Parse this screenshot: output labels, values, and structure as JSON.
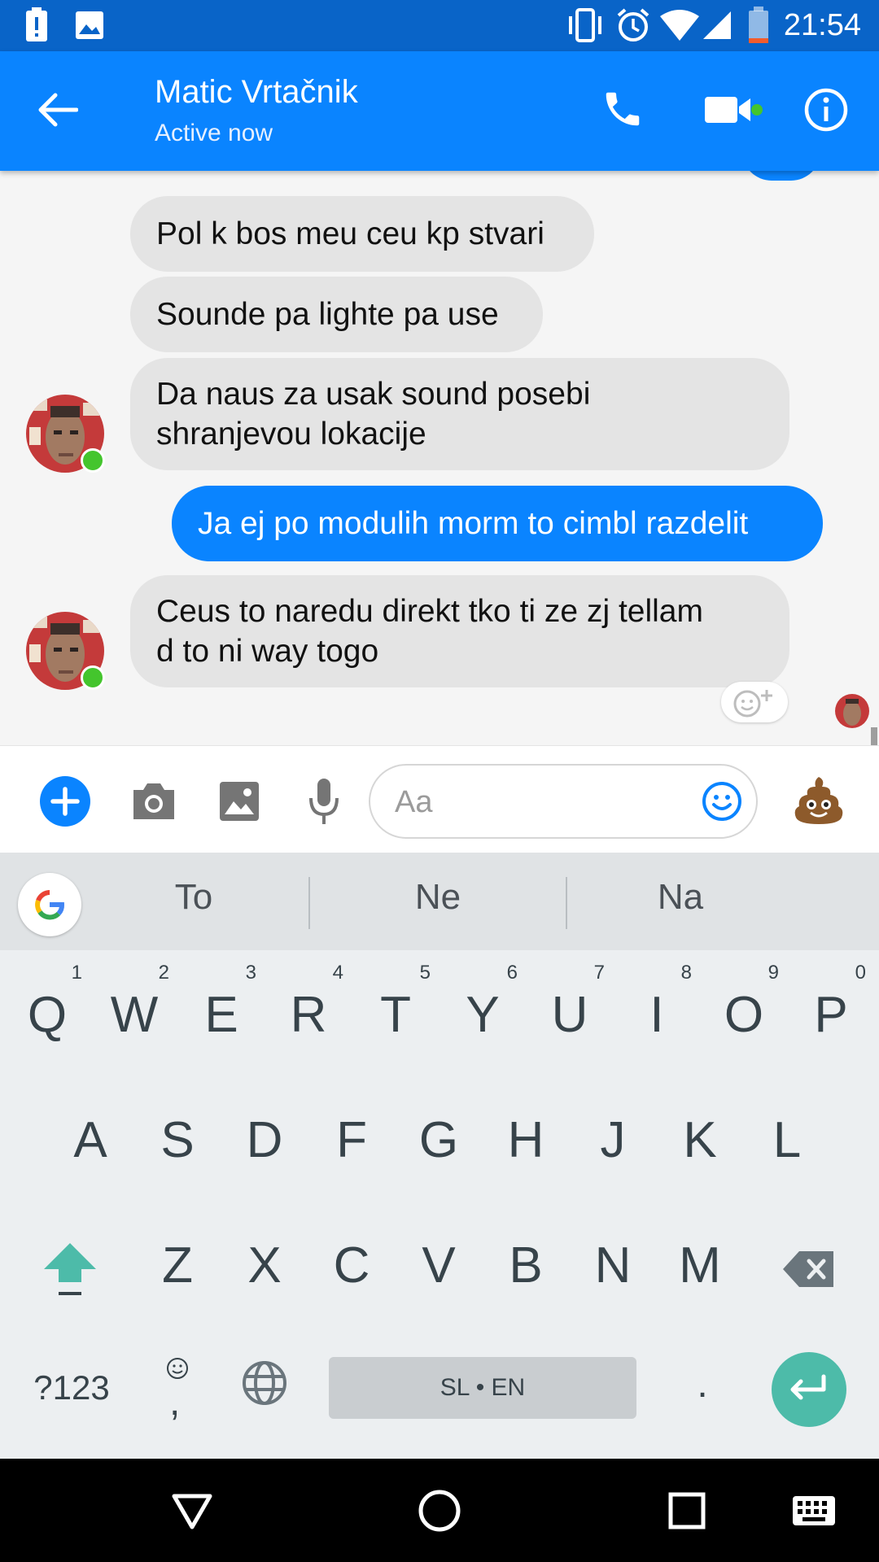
{
  "status_bar": {
    "time": "21:54"
  },
  "header": {
    "contact_name": "Matic Vrtačnik",
    "status": "Active now"
  },
  "messages": [
    {
      "side": "in",
      "text": "Pol k bos meu ceu kp stvari"
    },
    {
      "side": "in",
      "text": "Sounde pa lighte pa use"
    },
    {
      "side": "in",
      "lines": [
        "Da naus za usak sound posebi",
        "shranjevou lokacije"
      ]
    },
    {
      "side": "out",
      "text": "Ja ej po modulih morm to cimbl razdelit"
    },
    {
      "side": "in",
      "lines": [
        "Ceus to naredu direkt tko ti ze zj tellam",
        "d to ni way togo"
      ]
    }
  ],
  "composer": {
    "placeholder": "Aa"
  },
  "keyboard": {
    "suggestions": [
      "To",
      "Ne",
      "Na"
    ],
    "row1": [
      "Q",
      "W",
      "E",
      "R",
      "T",
      "Y",
      "U",
      "I",
      "O",
      "P"
    ],
    "row1_numbers": [
      "1",
      "2",
      "3",
      "4",
      "5",
      "6",
      "7",
      "8",
      "9",
      "0"
    ],
    "row2": [
      "A",
      "S",
      "D",
      "F",
      "G",
      "H",
      "J",
      "K",
      "L"
    ],
    "row3": [
      "Z",
      "X",
      "C",
      "V",
      "B",
      "N",
      "M"
    ],
    "symbols_label": "?123",
    "comma_label": ",",
    "space_label": "SL • EN",
    "period_label": "."
  },
  "colors": {
    "accent": "#0a84ff",
    "status_bar": "#0964c8",
    "online": "#44c52d",
    "enter_key": "#4dbba9"
  }
}
